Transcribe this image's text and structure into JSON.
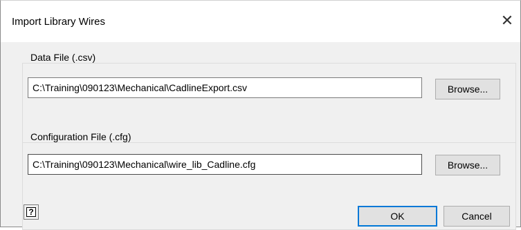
{
  "window": {
    "title": "Import Library Wires",
    "close_glyph": "✕"
  },
  "data_file": {
    "label": "Data File (.csv)",
    "value": "C:\\Training\\090123\\Mechanical\\CadlineExport.csv",
    "browse_label": "Browse..."
  },
  "config_file": {
    "label": "Configuration File (.cfg)",
    "value": "C:\\Training\\090123\\Mechanical\\wire_lib_Cadline.cfg",
    "browse_label": "Browse..."
  },
  "footer": {
    "help_glyph": "?",
    "ok_label": "OK",
    "cancel_label": "Cancel"
  },
  "colors": {
    "default_button_border": "#0078d7",
    "client_bg": "#f0f0f0"
  }
}
